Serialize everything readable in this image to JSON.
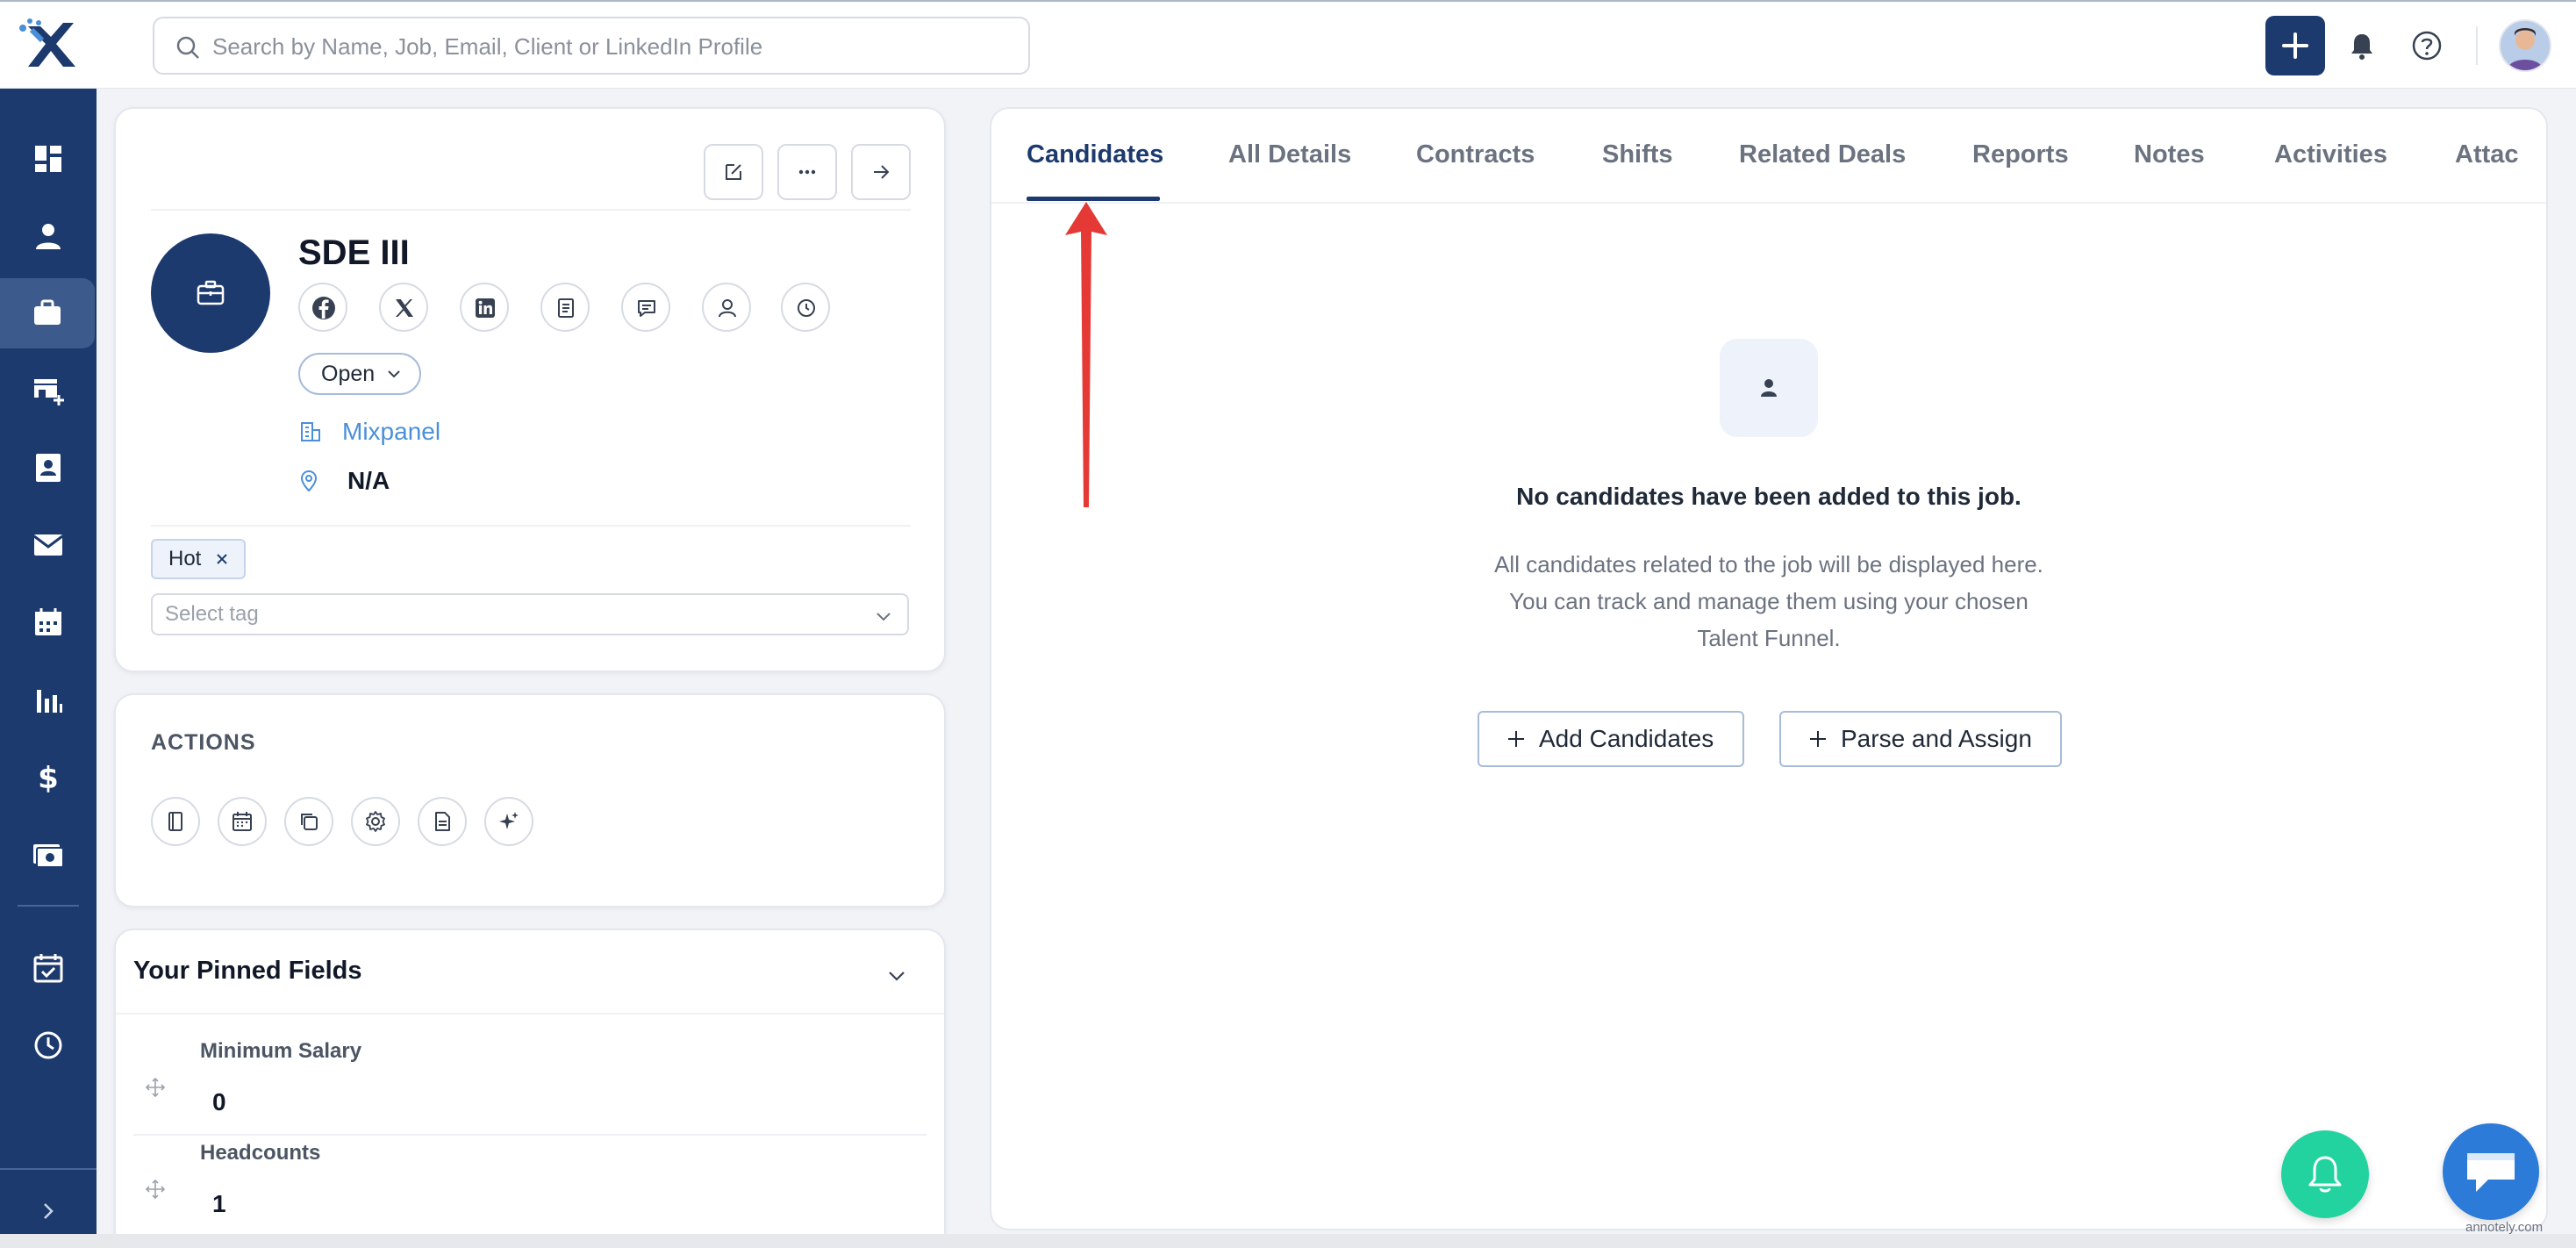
{
  "search": {
    "placeholder": "Search by Name, Job, Email, Client or LinkedIn Profile"
  },
  "job": {
    "title": "SDE III",
    "status": "Open",
    "company": "Mixpanel",
    "location": "N/A",
    "tags": [
      "Hot"
    ],
    "tag_placeholder": "Select tag"
  },
  "actions": {
    "title": "ACTIONS"
  },
  "pinned": {
    "title": "Your Pinned Fields",
    "fields": [
      {
        "label": "Minimum Salary",
        "value": "0"
      },
      {
        "label": "Headcounts",
        "value": "1"
      }
    ]
  },
  "tabs": [
    "Candidates",
    "All Details",
    "Contracts",
    "Shifts",
    "Related Deals",
    "Reports",
    "Notes",
    "Activities",
    "Attac"
  ],
  "active_tab": "Candidates",
  "empty_state": {
    "title": "No candidates have been added to this job.",
    "line1": "All candidates related to the job will be displayed here.",
    "line2": "You can track and manage them using your chosen",
    "line3": "Talent Funnel.",
    "add_button": "Add Candidates",
    "parse_button": "Parse and Assign"
  },
  "watermark": "annotely.com",
  "colors": {
    "brand": "#1c3a6e",
    "link": "#4a90d9",
    "annotation": "#e53935",
    "bell_fab": "#22d3a0",
    "chat_fab": "#2d7bd8"
  }
}
